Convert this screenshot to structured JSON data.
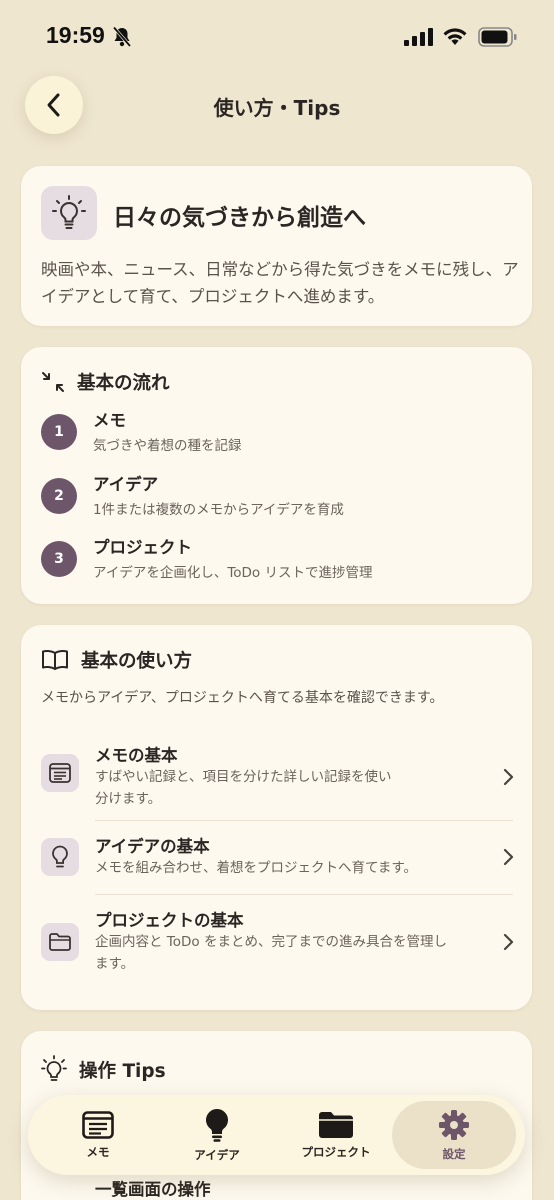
{
  "status_bar": {
    "time": "19:59"
  },
  "header": {
    "title": "使い方・Tips"
  },
  "hero": {
    "title": "日々の気づきから創造へ",
    "description": "映画や本、ニュース、日常などから得た気づきをメモに残し、アイデアとして育て、プロジェクトへ進めます。"
  },
  "flow": {
    "heading": "基本の流れ",
    "steps": [
      {
        "num": "1",
        "title": "メモ",
        "sub": "気づきや着想の種を記録"
      },
      {
        "num": "2",
        "title": "アイデア",
        "sub": "1件または複数のメモからアイデアを育成"
      },
      {
        "num": "3",
        "title": "プロジェクト",
        "sub": "アイデアを企画化し、ToDo リストで進捗管理"
      }
    ]
  },
  "usage": {
    "heading": "基本の使い方",
    "intro": "メモからアイデア、プロジェクトへ育てる基本を確認できます。",
    "items": [
      {
        "title": "メモの基本",
        "sub": "すばやい記録と、項目を分けた詳しい記録を使い分けます。",
        "icon": "memo-icon"
      },
      {
        "title": "アイデアの基本",
        "sub": "メモを組み合わせ、着想をプロジェクトへ育てます。",
        "icon": "lightbulb-icon"
      },
      {
        "title": "プロジェクトの基本",
        "sub": "企画内容と ToDo をまとめ、完了までの進み具合を管理します。",
        "icon": "folder-icon"
      }
    ]
  },
  "tips": {
    "heading": "操作 Tips",
    "peek_item": "一覧画面の操作"
  },
  "nav": {
    "items": [
      {
        "label": "メモ",
        "icon": "memo-icon"
      },
      {
        "label": "アイデア",
        "icon": "lightbulb-icon"
      },
      {
        "label": "プロジェクト",
        "icon": "folder-icon"
      },
      {
        "label": "設定",
        "icon": "gear-icon"
      }
    ],
    "active": "設定"
  },
  "colors": {
    "background": "#efe6d0",
    "card": "#fdf9ef",
    "accent": "#6d5669",
    "icon_bg": "#e6dde2"
  }
}
